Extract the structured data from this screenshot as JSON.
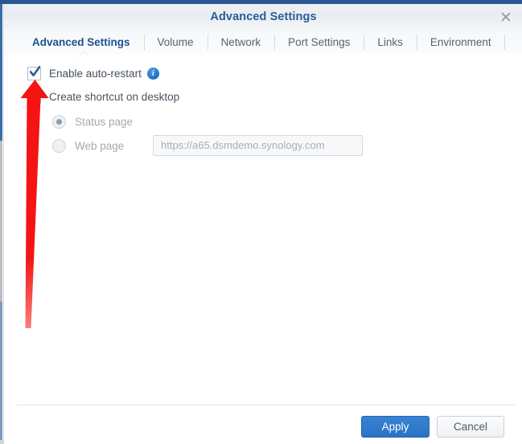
{
  "window": {
    "title": "Advanced Settings",
    "close_icon": "close-icon"
  },
  "tabs": [
    {
      "label": "Advanced Settings",
      "active": true
    },
    {
      "label": "Volume",
      "active": false
    },
    {
      "label": "Network",
      "active": false
    },
    {
      "label": "Port Settings",
      "active": false
    },
    {
      "label": "Links",
      "active": false
    },
    {
      "label": "Environment",
      "active": false
    }
  ],
  "form": {
    "auto_restart": {
      "label": "Enable auto-restart",
      "checked": true,
      "info_icon": "info-icon"
    },
    "create_shortcut": {
      "label": "Create shortcut on desktop",
      "checked": false
    },
    "shortcut_target": {
      "options": [
        {
          "label": "Status page",
          "selected": true,
          "disabled": true
        },
        {
          "label": "Web page",
          "selected": false,
          "disabled": true
        }
      ]
    },
    "web_page_url": {
      "value": "https://a65.dsmdemo.synology.com",
      "placeholder": "https://a65.dsmdemo.synology.com",
      "disabled": true
    }
  },
  "footer": {
    "apply_label": "Apply",
    "cancel_label": "Cancel"
  },
  "annotation": {
    "type": "arrow",
    "color": "#f41414",
    "points_to": "enable-auto-restart-checkbox"
  },
  "colors": {
    "title_blue": "#2a5c96",
    "accent_blue": "#2a72c4",
    "tab_active": "#1d5190",
    "top_bar": "#2b5691"
  }
}
